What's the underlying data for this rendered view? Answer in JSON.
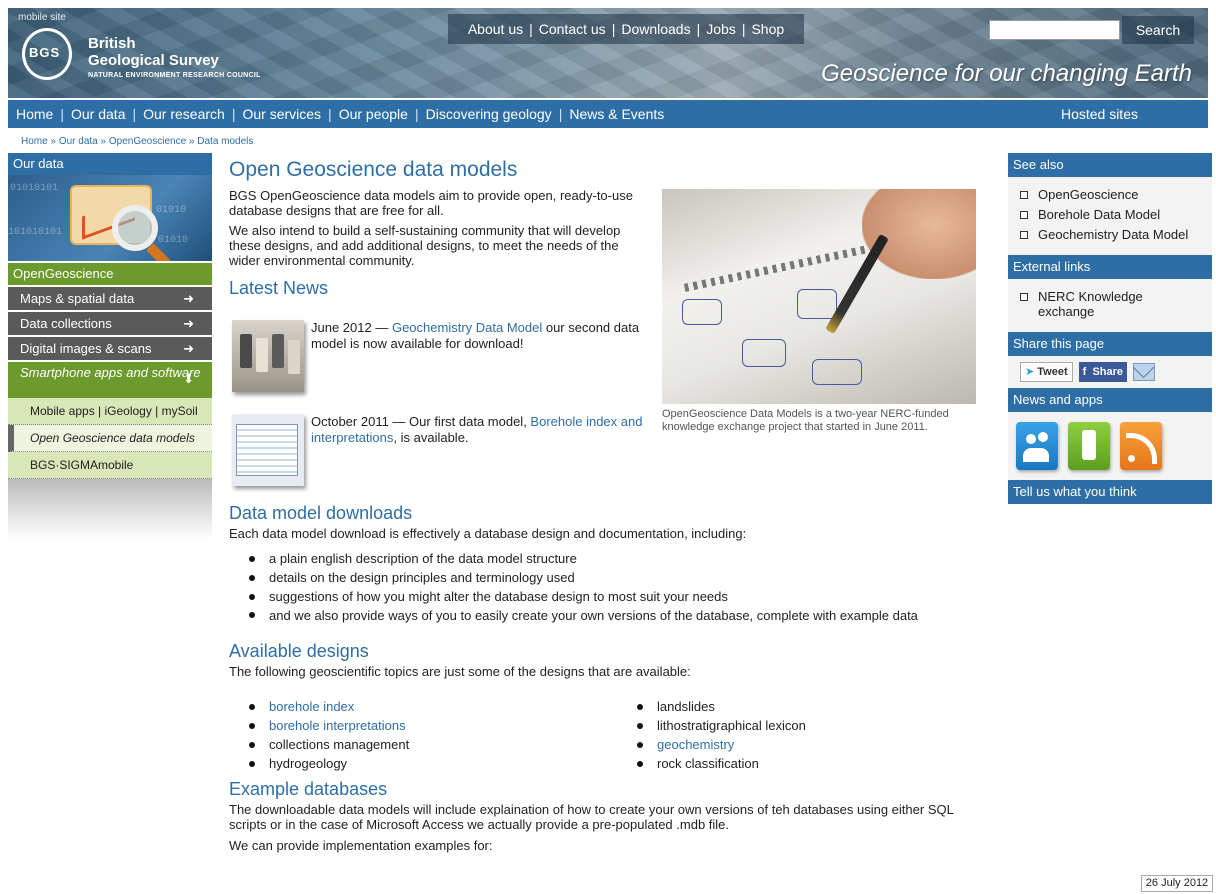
{
  "header": {
    "mobile_site": "mobile site",
    "logo_line1": "British",
    "logo_line2": "Geological Survey",
    "logo_sub": "NATURAL ENVIRONMENT RESEARCH COUNCIL",
    "tagline": "Geoscience for our changing Earth",
    "top_links": [
      "About us",
      "Contact us",
      "Downloads",
      "Jobs",
      "Shop"
    ],
    "search_value": "",
    "search_label": "Search"
  },
  "mainnav": {
    "items": [
      "Home",
      "Our data",
      "Our research",
      "Our services",
      "Our people",
      "Discovering geology",
      "News & Events"
    ],
    "hosted": "Hosted sites"
  },
  "breadcrumb": [
    "Home",
    "Our data",
    "OpenGeoscience",
    "Data models"
  ],
  "breadcrumb_sep": "»",
  "leftbar": {
    "title": "Our data",
    "section": "OpenGeoscience",
    "items": [
      "Maps & spatial data",
      "Data collections",
      "Digital images & scans"
    ],
    "open_item": "Smartphone apps and software",
    "arrow_right": "➜",
    "arrow_down": "⬇",
    "subitems": [
      "Mobile apps | iGeology | mySoil",
      "Open Geoscience data models",
      "BGS·SIGMAmobile"
    ]
  },
  "main": {
    "title": "Open Geoscience data models",
    "intro1": "BGS OpenGeoscience data models aim to provide open, ready-to-use database designs that are free for all.",
    "intro2": "We also intend to build a self-sustaining community that will develop these designs, and add additional designs, to meet the needs of the wider environmental community.",
    "news_heading": "Latest News",
    "news": [
      {
        "pre": "June 2012 — ",
        "link": "Geochemistry Data Model",
        "post": " our second data model is now available for download!"
      },
      {
        "pre": "October 2011 — Our first data model, ",
        "link": "Borehole index and interpretations",
        "post": ", is available."
      }
    ],
    "caption": "OpenGeoscience Data Models is a two-year NERC-funded knowledge exchange project that started in June 2011.",
    "downloads_heading": "Data model downloads",
    "downloads_intro": "Each data model download is effectively a database design and documentation, including:",
    "downloads_list": [
      "a plain english description of the data model structure",
      "details on the design principles and terminology used",
      "suggestions of how you might alter the database design to most suit your needs",
      "and we also provide ways of you to easily create your own versions of the database, complete with example data"
    ],
    "designs_heading": "Available designs",
    "designs_intro": "The following geoscientific topics are just some of the designs that are available:",
    "designs_col1": [
      "borehole index",
      "borehole interpretations",
      "collections management",
      "hydrogeology"
    ],
    "designs_col2": [
      "landslides",
      "lithostratigraphical lexicon",
      "geochemistry",
      "rock classification"
    ],
    "examples_heading": "Example databases",
    "examples_text": "The downloadable data models will include explaination of how to create your own versions of teh databases using either SQL scripts or in the case of Microsoft Access we actually provide a pre-populated .mdb file.",
    "examples_text2": "We can provide implementation examples for:"
  },
  "rightbar": {
    "see_also": "See also",
    "see_also_items": [
      "OpenGeoscience",
      "Borehole Data Model",
      "Geochemistry Data Model"
    ],
    "external": "External links",
    "external_items": [
      "NERC Knowledge exchange"
    ],
    "share": "Share this page",
    "tweet": "Tweet",
    "fb_share": "Share",
    "news_apps": "News and apps",
    "tell_us": "Tell us what you think"
  },
  "date_stamp": "26 July 2012",
  "colors": {
    "brand_blue": "#2e6ea6",
    "section_green": "#6c9a2c",
    "nav_gray": "#5a5a5a"
  }
}
